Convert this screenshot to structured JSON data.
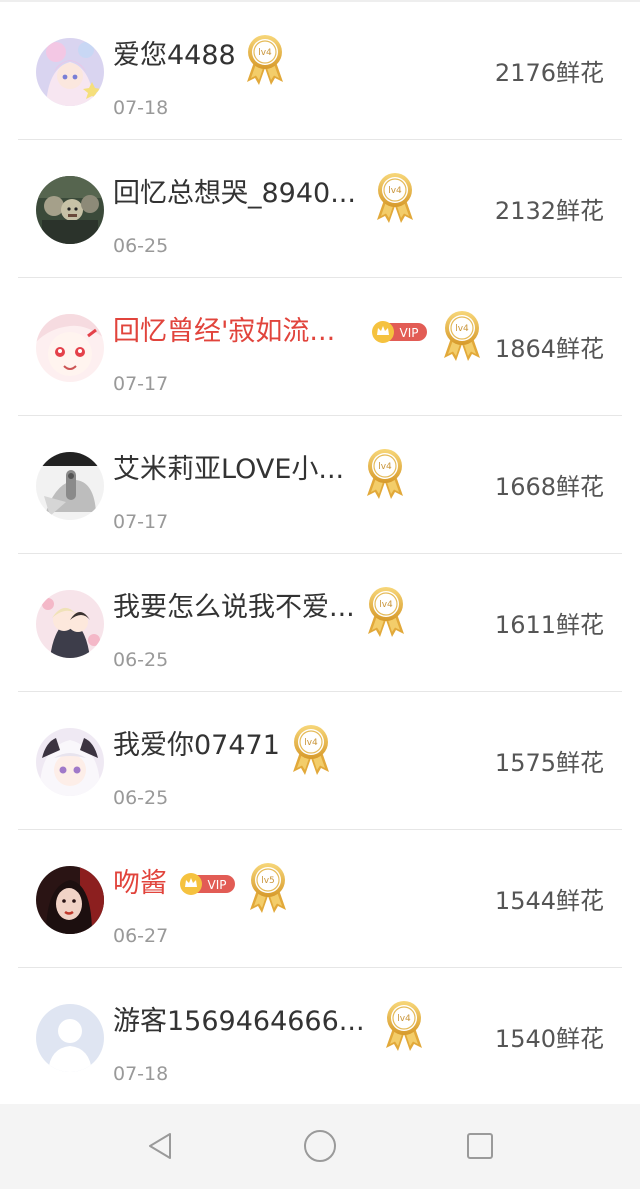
{
  "rows": [
    {
      "name": "爱您4488",
      "date": "07-18",
      "flowers": "2176鲜花",
      "level": "lv4",
      "vip": false,
      "avatar": "anime-girl-avatar"
    },
    {
      "name": "回忆总想哭_8940...",
      "date": "06-25",
      "flowers": "2132鲜花",
      "level": "lv4",
      "vip": false,
      "avatar": "group-photo-avatar"
    },
    {
      "name": "回忆曾经'寂如流...",
      "date": "07-17",
      "flowers": "1864鲜花",
      "level": "lv4",
      "vip": true,
      "vip_label": "VIP",
      "avatar": "anime-face-avatar"
    },
    {
      "name": "艾米莉亚LOVE小...",
      "date": "07-17",
      "flowers": "1668鲜花",
      "level": "lv4",
      "vip": false,
      "avatar": "grey-sketch-avatar"
    },
    {
      "name": "我要怎么说我不爱...",
      "date": "06-25",
      "flowers": "1611鲜花",
      "level": "lv4",
      "vip": false,
      "avatar": "anime-couple-avatar"
    },
    {
      "name": "我爱你07471",
      "date": "06-25",
      "flowers": "1575鲜花",
      "level": "lv4",
      "vip": false,
      "avatar": "white-hair-anime-avatar"
    },
    {
      "name": "吻酱",
      "date": "06-27",
      "flowers": "1544鲜花",
      "level": "lv5",
      "vip": true,
      "vip_label": "VIP",
      "avatar": "dark-portrait-avatar"
    },
    {
      "name": "游客1569464666...",
      "date": "07-18",
      "flowers": "1540鲜花",
      "level": "lv4",
      "vip": false,
      "avatar": "default-guest-avatar"
    }
  ],
  "colors": {
    "name_default": "#333333",
    "name_vip": "#e1443c",
    "date": "#999999",
    "flowers": "#555555",
    "medal_gold": "#e6b34a",
    "vip_red": "#e25c55",
    "navbar_bg": "#f4f4f4"
  },
  "navbar": {
    "back_icon": "triangle-back-icon",
    "home_icon": "circle-home-icon",
    "recents_icon": "square-recents-icon"
  }
}
